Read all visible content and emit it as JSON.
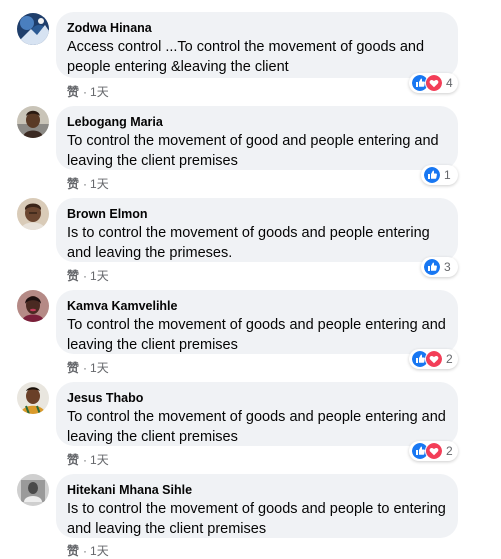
{
  "colors": {
    "like_blue": "#1877f2",
    "love_red": "#f33e58",
    "bubble_bg": "#f0f2f5",
    "meta_gray": "#65676b"
  },
  "comments": [
    {
      "author": "Zodwa Hinana",
      "text": "Access control ...To control the movement of goods and people entering &leaving the client",
      "like_label": "赞",
      "time": "1天",
      "reactions": [
        "like-icon",
        "love-icon"
      ],
      "reaction_count": "4"
    },
    {
      "author": "Lebogang Maria",
      "text": "To control the movement of good and people entering and leaving the client premises",
      "like_label": "赞",
      "time": "1天",
      "reactions": [
        "like-icon"
      ],
      "reaction_count": "1"
    },
    {
      "author": "Brown Elmon",
      "text": "Is to control the movement of goods and people entering and leaving the primeses.",
      "like_label": "赞",
      "time": "1天",
      "reactions": [
        "like-icon"
      ],
      "reaction_count": "3"
    },
    {
      "author": "Kamva Kamvelihle",
      "text": "To control the movement of goods and people entering and leaving the client premises",
      "like_label": "赞",
      "time": "1天",
      "reactions": [
        "like-icon",
        "love-icon"
      ],
      "reaction_count": "2"
    },
    {
      "author": "Jesus Thabo",
      "text": "To control the movement of goods and people entering and leaving the client premises",
      "like_label": "赞",
      "time": "1天",
      "reactions": [
        "like-icon",
        "love-icon"
      ],
      "reaction_count": "2"
    },
    {
      "author": "Hitekani Mhana Sihle",
      "text": "Is to control the movement of goods and people to entering and leaving the client premises",
      "like_label": "赞",
      "time": "1天"
    }
  ]
}
